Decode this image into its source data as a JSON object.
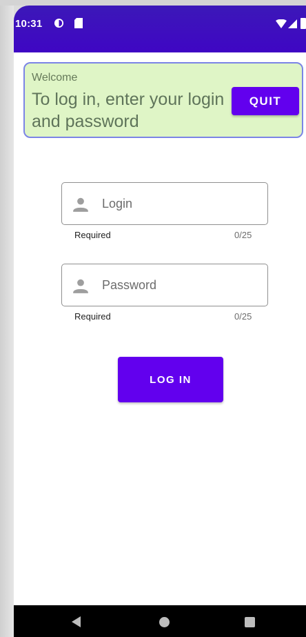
{
  "status_bar": {
    "time": "10:31",
    "icons": [
      "data-saver-icon",
      "sd-card-icon",
      "wifi-icon",
      "signal-icon",
      "battery-icon"
    ]
  },
  "welcome": {
    "small": "Welcome",
    "big": "To log in, enter your login and password",
    "quit_label": "QUIT"
  },
  "form": {
    "login": {
      "placeholder": "Login",
      "helper": "Required",
      "counter": "0/25",
      "icon": "person-icon"
    },
    "password": {
      "placeholder": "Password",
      "helper": "Required",
      "counter": "0/25",
      "icon": "person-icon"
    },
    "submit_label": "LOG IN"
  },
  "colors": {
    "primary": "#6200ee",
    "status_bar": "#3f06c4",
    "card_background": "#dff5c6",
    "card_border": "#7b84e6"
  },
  "nav_bar": {
    "icons": [
      "back-icon",
      "home-icon",
      "recents-icon"
    ]
  }
}
